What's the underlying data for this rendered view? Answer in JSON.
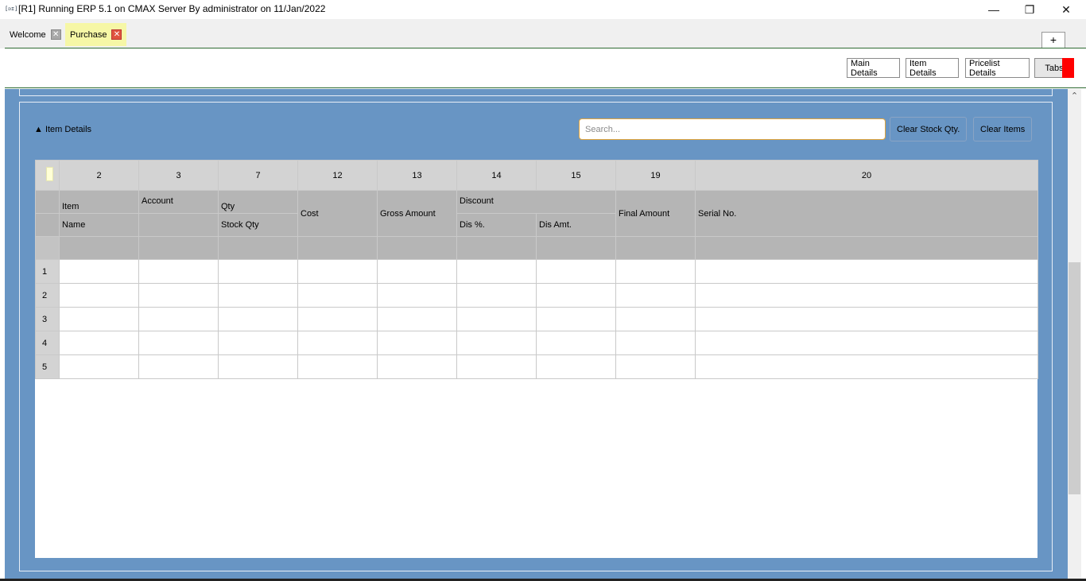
{
  "window": {
    "app_icon": "[ᴅɪ]",
    "title": "[R1] Running ERP 5.1 on CMAX Server By administrator on 11/Jan/2022",
    "minimize": "—",
    "restore": "❐",
    "close": "✕"
  },
  "tabs": [
    {
      "label": "Welcome",
      "close": "✕"
    },
    {
      "label": "Purchase",
      "close": "✕"
    }
  ],
  "new_tab": "+",
  "toolbar": {
    "main_details": "Main Details",
    "item_details": "Item Details",
    "pricelist_details": "Pricelist Details",
    "tabs": "Tabs"
  },
  "section": {
    "title": "▲ Item Details",
    "search_placeholder": "Search...",
    "clear_stock": "Clear Stock Qty.",
    "clear_items": "Clear Items"
  },
  "grid": {
    "column_numbers": [
      "2",
      "3",
      "7",
      "12",
      "13",
      "14",
      "15",
      "19",
      "20"
    ],
    "headers": {
      "item": "Item",
      "name": "Name",
      "account": "Account",
      "qty": "Qty",
      "stock_qty": "Stock Qty",
      "cost": "Cost",
      "gross_amount": "Gross Amount",
      "discount": "Discount",
      "dis_pct": "Dis %.",
      "dis_amt": "Dis Amt.",
      "final_amount": "Final Amount",
      "serial_no": "Serial No."
    },
    "rows": [
      "1",
      "2",
      "3",
      "4",
      "5"
    ]
  },
  "scroll_up": "⌃"
}
